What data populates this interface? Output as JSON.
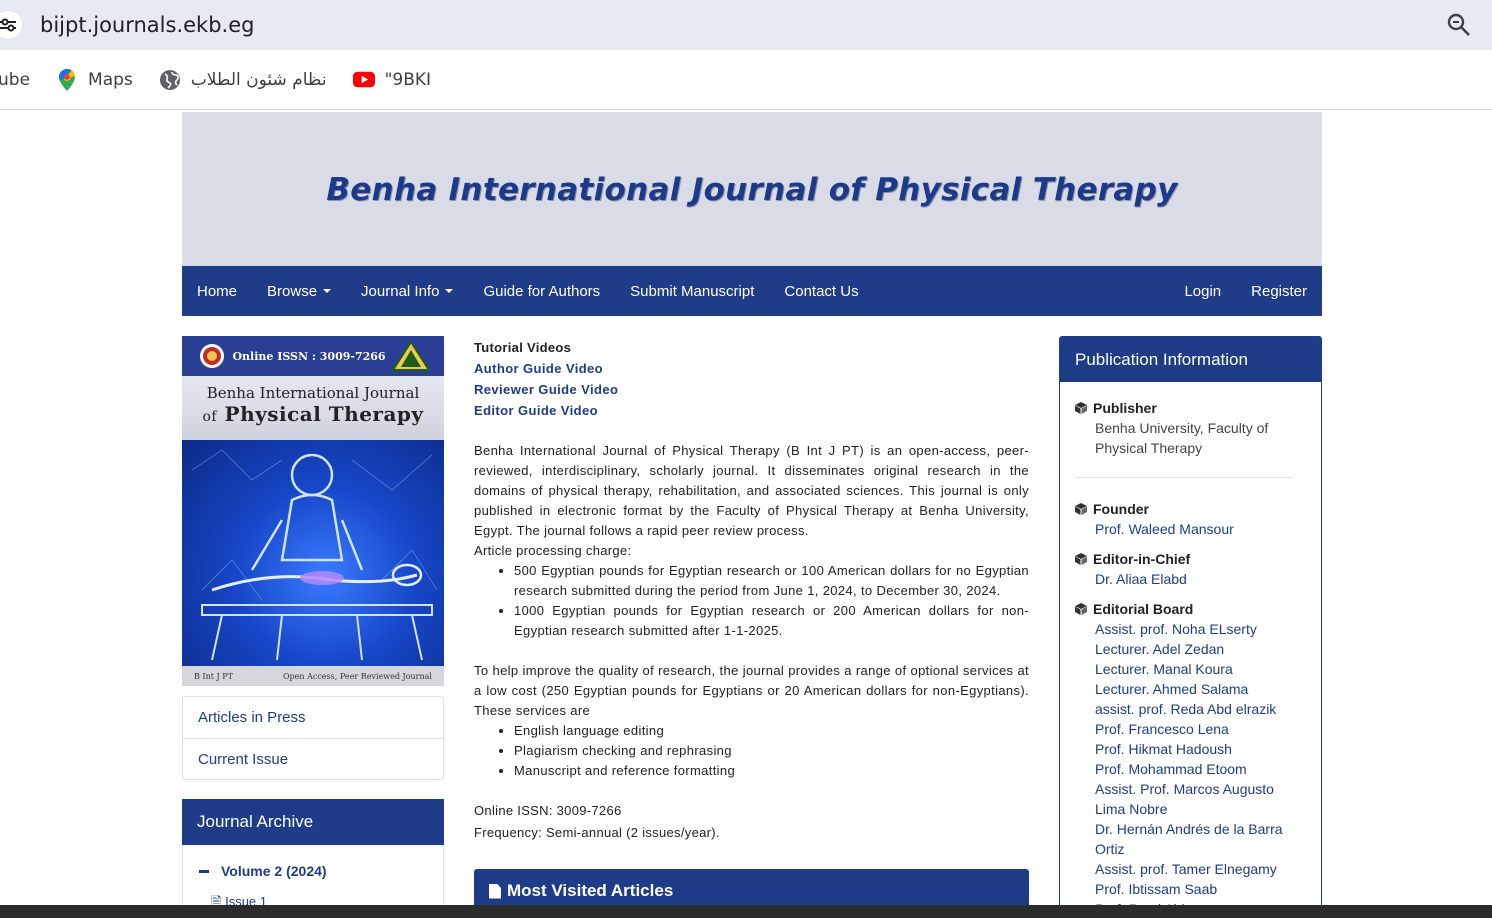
{
  "browser": {
    "url": "bijpt.journals.ekb.eg",
    "bookmarks": [
      {
        "label": "ube",
        "icon": "youtube-icon"
      },
      {
        "label": "Maps",
        "icon": "maps-pin-icon"
      },
      {
        "label": "نظام شئون الطلاب",
        "icon": "globe-icon"
      },
      {
        "label": "\"9BKI",
        "icon": "youtube-icon"
      }
    ]
  },
  "banner": {
    "title": "Benha International Journal of Physical Therapy"
  },
  "nav": {
    "home": "Home",
    "browse": "Browse",
    "journal_info": "Journal Info",
    "guide": "Guide for Authors",
    "submit": "Submit Manuscript",
    "contact": "Contact Us",
    "login": "Login",
    "register": "Register"
  },
  "cover": {
    "issn": "Online ISSN : 3009-7266",
    "title_line1": "Benha International Journal",
    "title_of": "of",
    "title_line2": "Physical Therapy",
    "foot_left": "B Int J PT",
    "foot_right": "Open Access, Peer Reviewed Journal"
  },
  "side_links": {
    "articles_in_press": "Articles in Press",
    "current_issue": "Current Issue"
  },
  "archive": {
    "title": "Journal Archive",
    "volume": "Volume 2 (2024)",
    "issue": "Issue 1"
  },
  "main": {
    "tutorial_heading": "Tutorial Videos",
    "author_video": "Author Guide Video",
    "reviewer_video": "Reviewer Guide Video",
    "editor_video": "Editor Guide Video",
    "description": "Benha International Journal of Physical Therapy (B Int J PT) is an open-access, peer-reviewed, interdisciplinary, scholarly journal. It disseminates original research in the domains of physical therapy, rehabilitation, and associated sciences. This journal is only published in electronic format by the Faculty of Physical Therapy at Benha University, Egypt. The journal follows a rapid peer review process.",
    "apc_heading": "Article processing charge:",
    "apc_items": [
      "500 Egyptian pounds for Egyptian research or 100 American dollars for no Egyptian research submitted during the period from June 1, 2024, to December 30, 2024.",
      "1000 Egyptian pounds for Egyptian research or 200 American dollars for non-Egyptian research submitted after 1-1-2025."
    ],
    "services_intro": "To help improve the quality of research, the journal provides a range of optional services at a low cost (250 Egyptian pounds for Egyptians or 20 American dollars for non-Egyptians). These services are",
    "services": [
      "English language editing",
      "Plagiarism checking and rephrasing",
      "Manuscript and reference formatting"
    ],
    "issn": "Online ISSN: 3009-7266",
    "frequency": "Frequency: Semi-annual (2 issues/year).",
    "most_visited": "Most Visited Articles"
  },
  "publication": {
    "title": "Publication Information",
    "publisher_label": "Publisher",
    "publisher_value": "Benha University, Faculty of Physical Therapy",
    "founder_label": "Founder",
    "founder_value": "Prof. Waleed Mansour",
    "eic_label": "Editor-in-Chief",
    "eic_value": "Dr. Aliaa Elabd",
    "board_label": "Editorial Board",
    "board": [
      "Assist. prof. Noha ELserty",
      "Lecturer. Adel Zedan",
      "Lecturer. Manal Koura",
      "Lecturer. Ahmed Salama",
      "assist. prof. Reda Abd elrazik",
      "Prof. Francesco Lena",
      "Prof. Hikmat Hadoush",
      "Prof. Mohammad Etoom",
      "Assist. Prof. Marcos Augusto Lima Nobre",
      "Dr. Hernán Andrés de la Barra Ortiz",
      "Assist. prof. Tamer Elnegamy",
      "Prof. Ibtissam Saab",
      "Prof. Rami Abbas"
    ]
  },
  "colors": {
    "brand": "#1f3c88",
    "banner_bg": "#d9dbe6"
  }
}
